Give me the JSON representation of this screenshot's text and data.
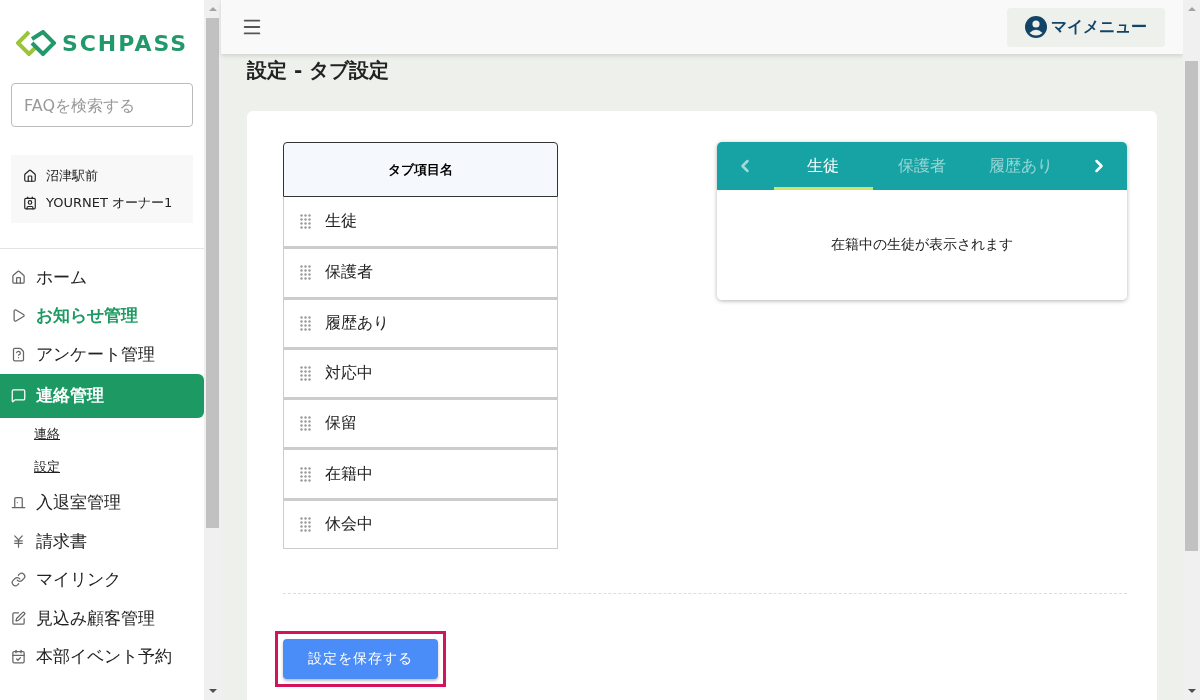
{
  "sidebar": {
    "logo": "SCHPASS",
    "search": {
      "placeholder": "FAQを検索する"
    },
    "account": {
      "school": "沼津駅前",
      "user": "YOURNET オーナー1"
    },
    "items": [
      {
        "label": "ホーム",
        "selected": false,
        "emphasized": false
      },
      {
        "label": "お知らせ管理",
        "selected": false,
        "emphasized": true
      },
      {
        "label": "アンケート管理",
        "selected": false,
        "emphasized": false
      },
      {
        "label": "連絡管理",
        "selected": true,
        "emphasized": false,
        "children": [
          {
            "label": "連絡"
          },
          {
            "label": "設定"
          }
        ]
      },
      {
        "label": "入退室管理",
        "selected": false,
        "emphasized": false
      },
      {
        "label": "請求書",
        "selected": false,
        "emphasized": false
      },
      {
        "label": "マイリンク",
        "selected": false,
        "emphasized": false
      },
      {
        "label": "見込み顧客管理",
        "selected": false,
        "emphasized": false
      },
      {
        "label": "本部イベント予約",
        "selected": false,
        "emphasized": false
      }
    ]
  },
  "header": {
    "my_menu": "マイメニュー"
  },
  "page_title": "設定 - タブ設定",
  "table": {
    "column": "タブ項目名",
    "rows": [
      "生徒",
      "保護者",
      "履歴あり",
      "対応中",
      "保留",
      "在籍中",
      "休会中"
    ]
  },
  "preview": {
    "tabs": [
      {
        "label": "生徒",
        "selected": true
      },
      {
        "label": "保護者",
        "selected": false
      },
      {
        "label": "履歴あり",
        "selected": false
      }
    ],
    "message": "在籍中の生徒が表示されます"
  },
  "save_button": {
    "label": "設定を保存する",
    "highlighted": true
  }
}
